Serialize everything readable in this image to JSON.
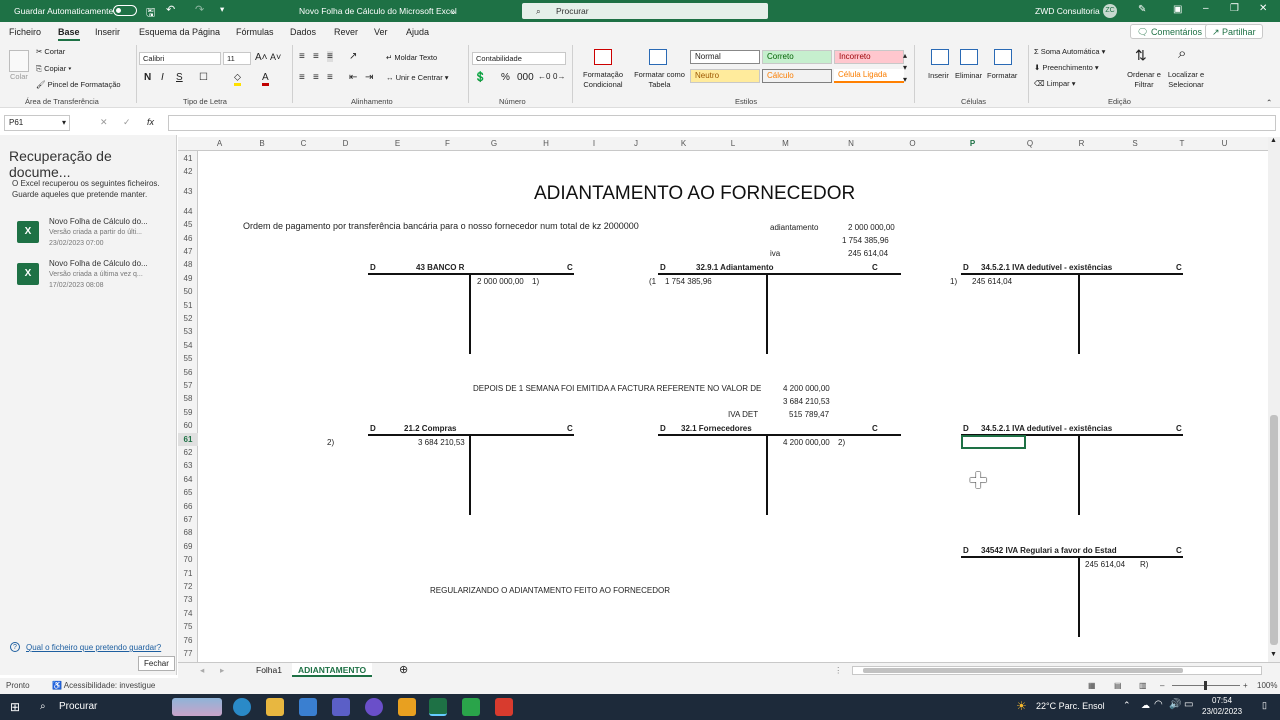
{
  "titlebar": {
    "autosave": "Guardar Automaticamente",
    "doc_title": "Novo Folha de Cálculo do Microsoft Excel",
    "search": "Procurar",
    "user": "ZWD Consultoria",
    "initials": "ZC"
  },
  "menu": {
    "tabs": [
      "Ficheiro",
      "Base",
      "Inserir",
      "Esquema da Página",
      "Fórmulas",
      "Dados",
      "Rever",
      "Ver",
      "Ajuda"
    ],
    "comments": "Comentários",
    "share": "Partilhar"
  },
  "ribbon": {
    "paste": "Colar",
    "cut": "Cortar",
    "copy": "Copiar",
    "format_painter": "Pincel de Formatação",
    "clipboard_group": "Área de Transferência",
    "font": "Calibri",
    "font_size": "11",
    "font_group": "Tipo de Letra",
    "wrap_text": "Moldar Texto",
    "merge_center": "Unir e Centrar",
    "alignment_group": "Alinhamento",
    "number_format": "Contabilidade",
    "number_group": "Número",
    "conditional": "Formatação Condicional",
    "format_table": "Formatar como Tabela",
    "style_normal": "Normal",
    "style_correct": "Correto",
    "style_incorrect": "Incorreto",
    "style_neutral": "Neutro",
    "style_calc": "Cálculo",
    "style_linked": "Célula Ligada",
    "styles_group": "Estilos",
    "insert": "Inserir",
    "delete": "Eliminar",
    "format": "Formatar",
    "cells_group": "Células",
    "autosum": "Soma Automática",
    "fill": "Preenchimento",
    "clear": "Limpar",
    "sort_filter": "Ordenar e Filtrar",
    "find_select": "Localizar e Selecionar",
    "editing_group": "Edição"
  },
  "formula_bar": {
    "name_box": "P61",
    "fx": "fx",
    "value": ""
  },
  "recovery": {
    "title": "Recuperação de docume...",
    "description": "O Excel recuperou os seguintes ficheiros. Guarde aqueles que pretende manter.",
    "files": [
      {
        "name": "Novo Folha de Cálculo do...",
        "status": "Versão criada a partir do últi...",
        "date": "23/02/2023 07:00"
      },
      {
        "name": "Novo Folha de Cálculo do...",
        "status": "Versão criada a última vez q...",
        "date": "17/02/2023 08:08"
      }
    ],
    "link": "Qual o ficheiro que pretendo guardar?",
    "close": "Fechar"
  },
  "columns": [
    "A",
    "B",
    "C",
    "D",
    "E",
    "F",
    "G",
    "H",
    "I",
    "J",
    "K",
    "L",
    "M",
    "N",
    "O",
    "P",
    "Q",
    "R",
    "S",
    "T",
    "U"
  ],
  "active_column": "P",
  "rows": [
    "41",
    "42",
    "43",
    "44",
    "45",
    "46",
    "47",
    "48",
    "49",
    "50",
    "51",
    "52",
    "53",
    "54",
    "55",
    "56",
    "57",
    "58",
    "59",
    "60",
    "61",
    "62",
    "63",
    "64",
    "65",
    "66",
    "67",
    "68",
    "69",
    "70",
    "71",
    "72",
    "73",
    "74",
    "75",
    "76",
    "77"
  ],
  "active_row": "61",
  "sheet": {
    "title": "ADIANTAMENTO AO FORNECEDOR",
    "order_text": "Ordem de pagamento por transferência bancária para o nosso fornecedor num total de kz 2000000",
    "lbl_adiantamento": "adiantamento",
    "val_adiantamento": "2 000 000,00",
    "val_base": "1 754 385,96",
    "lbl_iva": "iva",
    "val_iva": "245 614,04",
    "t1_d": "D",
    "t1_title": "43 BANCO R",
    "t1_c": "C",
    "t1_val": "2 000 000,00",
    "t1_ref": "1)",
    "t2_d": "D",
    "t2_title": "32.9.1 Adiantamento",
    "t2_c": "C",
    "t2_ref": "(1",
    "t2_val": "1 754 385,96",
    "t3_d": "D",
    "t3_title": "34.5.2.1 IVA dedutível - existências",
    "t3_c": "C",
    "t3_ref": "1)",
    "t3_val": "245 614,04",
    "invoice_text": "DEPOIS DE 1 SEMANA FOI EMITIDA A FACTURA REFERENTE  NO VALOR DE",
    "inv_total": "4 200 000,00",
    "inv_base": "3 684 210,53",
    "lbl_iva_det": "IVA DET",
    "inv_iva": "515 789,47",
    "t4_d": "D",
    "t4_title": "21.2 Compras",
    "t4_c": "C",
    "t4_ref": "2)",
    "t4_val": "3 684 210,53",
    "t5_d": "D",
    "t5_title": "32.1 Fornecedores",
    "t5_c": "C",
    "t5_val": "4 200 000,00",
    "t5_ref": "2)",
    "t6_d": "D",
    "t6_title": "34.5.2.1 IVA dedutível - existências",
    "t6_c": "C",
    "t7_d": "D",
    "t7_title": "34542 IVA Regulari a favor do Estad",
    "t7_c": "C",
    "t7_val": "245 614,04",
    "t7_ref": "R)",
    "regularize_text": "REGULARIZANDO O ADIANTAMENTO FEITO AO FORNECEDOR"
  },
  "sheet_tabs": [
    "Folha1",
    "ADIANTAMENTO"
  ],
  "status": {
    "ready": "Pronto",
    "accessibility": "Acessibilidade: investigue",
    "zoom": "100%"
  },
  "taskbar": {
    "search": "Procurar",
    "weather": "22°C  Parc. Ensol",
    "time": "07:54",
    "date": "23/02/2023"
  }
}
